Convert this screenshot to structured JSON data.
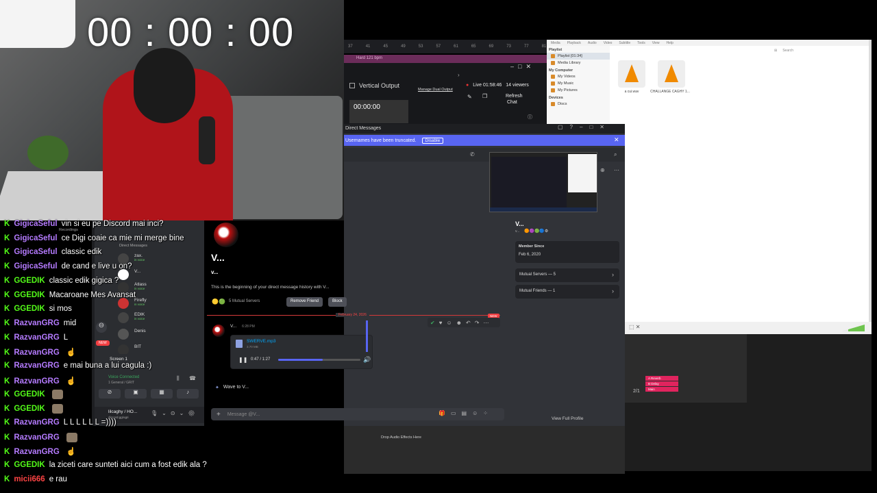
{
  "webcam": {
    "timer": "00 : 00 : 00"
  },
  "obs": {
    "ruler": [
      "37",
      "41",
      "45",
      "49",
      "53",
      "57",
      "61",
      "65",
      "69",
      "73",
      "77",
      "81"
    ],
    "pink_label": "Hard 121 bpm",
    "vertical_output": "Vertical Output",
    "manage_dual": "Manage Dual Output",
    "preview_time": "00:00:00",
    "live_time": "Live 01:58:46",
    "viewers": "14 viewers",
    "refresh": "Refresh",
    "chat": "Chat"
  },
  "vlc": {
    "menu": [
      "Media",
      "Playback",
      "Audio",
      "Video",
      "Subtitle",
      "Tools",
      "View",
      "Help"
    ],
    "sections": [
      {
        "title": "Playlist",
        "items": [
          "Playlist [01:34]",
          "Media Library"
        ]
      },
      {
        "title": "My Computer",
        "items": [
          "My Videos",
          "My Music",
          "My Pictures"
        ]
      },
      {
        "title": "Devices",
        "items": [
          "Discs"
        ]
      }
    ],
    "search_placeholder": "Search",
    "files": [
      "a cui.wav",
      "CHALLANGE CAGHY 1..."
    ]
  },
  "discord": {
    "window_title": "Direct Messages",
    "banner_text": "Usernames have been truncated.",
    "banner_button": "Disable",
    "dm_header": "Direct Messages",
    "dm_list": [
      {
        "name": "zax.",
        "status": "in voice"
      },
      {
        "name": "V...",
        "status": ""
      },
      {
        "name": "Atlass",
        "status": "in voice"
      },
      {
        "name": "Firefly",
        "status": "in voice"
      },
      {
        "name": "EDIK",
        "status": "in voice"
      },
      {
        "name": "Denis",
        "status": ""
      },
      {
        "name": "BIT",
        "status": ""
      }
    ],
    "screen_label": "Screen 1",
    "voice_connected": "Voice Connected",
    "voice_channel": "1 General / GRIT",
    "user_name": "lilcaghy / HO...",
    "user_status": "discord.gg/ogri",
    "recordings": "Recordings",
    "new_badge": "NEW",
    "profile_big_name": "V...",
    "profile_small_name": "v...",
    "history_text": "This is the beginning of your direct message history with V...",
    "mutual_servers_short": "5 Mutual Servers",
    "remove_friend": "Remove Friend",
    "block": "Block",
    "date_divider": "February 24, 2026",
    "new_marker": "NEW",
    "message_author": "V...",
    "message_time": "6:28 PM",
    "file_name": "SWERVE.mp3",
    "file_size": "3.70 MB",
    "audio_time": "0:47 / 1:27",
    "audio_progress": 0.54,
    "wave_text": "Wave to V...",
    "input_placeholder": "Message @V...",
    "side_name": "V...",
    "side_sub": "v...",
    "member_since_label": "Member Since",
    "member_since": "Feb 6, 2020",
    "mutual_servers": "Mutual Servers — 5",
    "mutual_friends": "Mutual Friends — 1",
    "view_full_profile": "View Full Profile"
  },
  "daw": {
    "tracks": [
      {
        "name": "A Reverb",
        "color": "#e0245e"
      },
      {
        "name": "B Delay",
        "color": "#e0245e"
      },
      {
        "name": "Main",
        "color": "#e0245e"
      }
    ],
    "position": "2/1",
    "drop_text": "Drop Audio Effects Here"
  },
  "chat": {
    "platform_icon": "K",
    "messages": [
      {
        "user": "GigicaSeful",
        "color": "#b57bff",
        "text": "vin si eu pe Discord mai inci?"
      },
      {
        "user": "GigicaSeful",
        "color": "#b57bff",
        "text": "ce Digi coaie ca mie mi merge bine"
      },
      {
        "user": "GigicaSeful",
        "color": "#b57bff",
        "text": "classic edik"
      },
      {
        "user": "GigicaSeful",
        "color": "#b57bff",
        "text": "de cand e live u on?"
      },
      {
        "user": "GGEDIK",
        "color": "#53fc18",
        "text": "classic edik gigica ?"
      },
      {
        "user": "GGEDIK",
        "color": "#53fc18",
        "text": "Macaroane Mes Avansat"
      },
      {
        "user": "GGEDIK",
        "color": "#53fc18",
        "text": "si mos"
      },
      {
        "user": "RazvanGRG",
        "color": "#b57bff",
        "text": "mid"
      },
      {
        "user": "RazvanGRG",
        "color": "#b57bff",
        "text": "L"
      },
      {
        "user": "RazvanGRG",
        "color": "#b57bff",
        "text": ""
      },
      {
        "user": "RazvanGRG",
        "color": "#b57bff",
        "text": "e mai buna a lui cagula :)"
      },
      {
        "user": "RazvanGRG",
        "color": "#b57bff",
        "text": ""
      },
      {
        "user": "GGEDIK",
        "color": "#53fc18",
        "text": ""
      },
      {
        "user": "GGEDIK",
        "color": "#53fc18",
        "text": ""
      },
      {
        "user": "RazvanGRG",
        "color": "#b57bff",
        "text": "L L L L L L =))))"
      },
      {
        "user": "RazvanGRG",
        "color": "#b57bff",
        "text": ""
      },
      {
        "user": "RazvanGRG",
        "color": "#b57bff",
        "text": ""
      },
      {
        "user": "GGEDIK",
        "color": "#53fc18",
        "text": "la ziceti care sunteti aici cum a fost edik ala ?"
      },
      {
        "user": "micii666",
        "color": "#ff4444",
        "text": "e rau"
      }
    ]
  }
}
